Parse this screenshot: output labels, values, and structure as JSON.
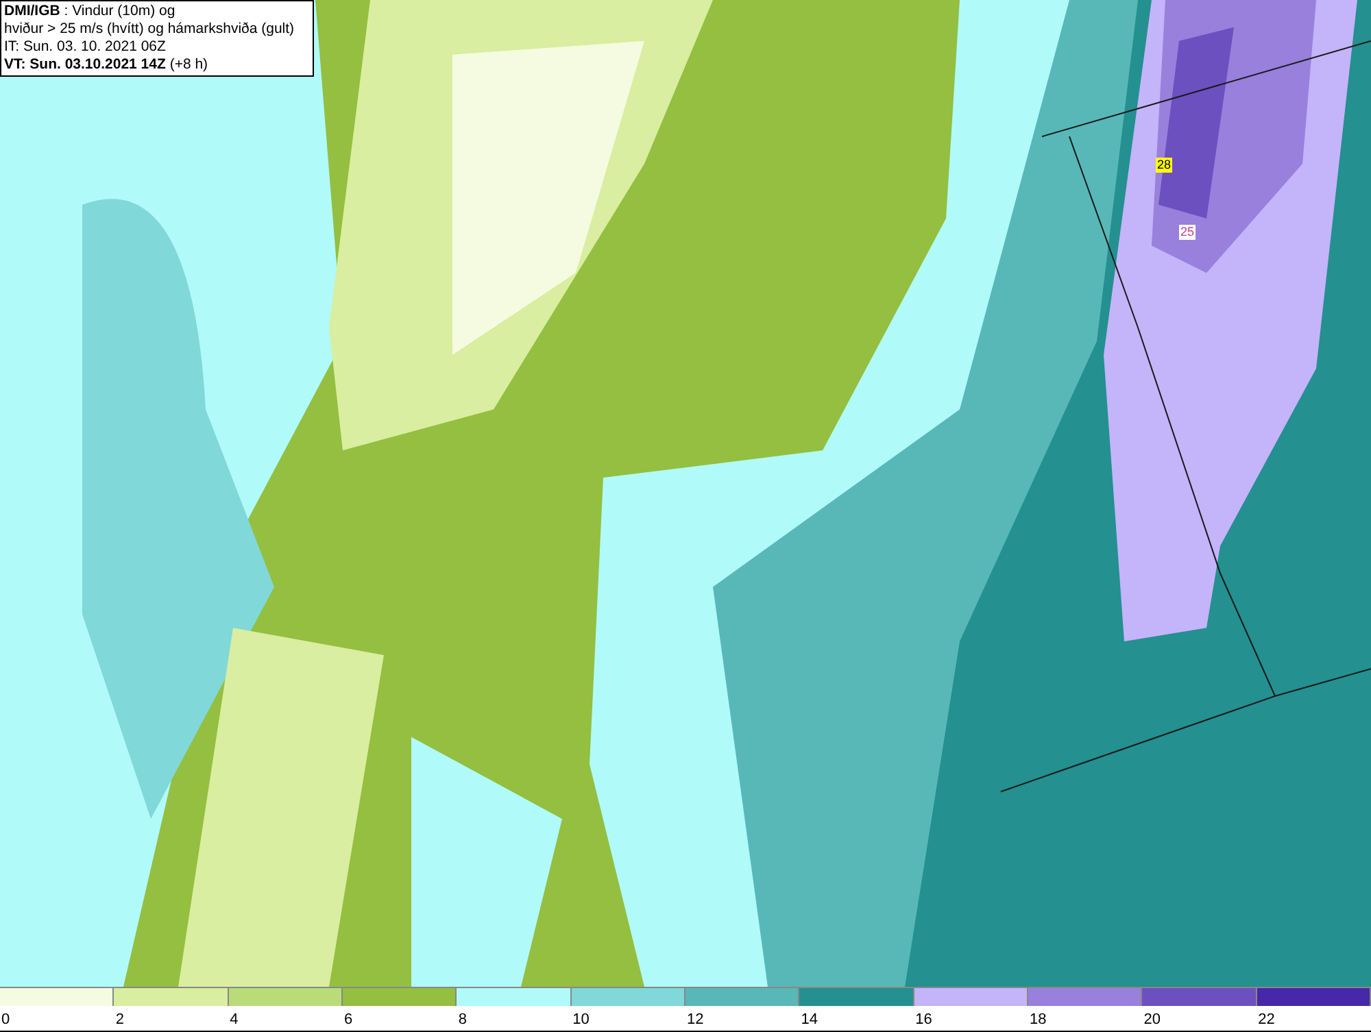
{
  "title_box": {
    "lines": [
      "**DMI/IGB** : Vindur (10m) og",
      "hviður > 25 m/s (hvítt) og hámarkshviða (gult)",
      "IT: Sun. 03. 10. 2021 06Z",
      "**VT: Sun. 03.10.2021 14Z** (+8 h)"
    ]
  },
  "map_labels": [
    {
      "text": "28",
      "kind": "gust"
    },
    {
      "text": "25",
      "kind": "isoline"
    }
  ],
  "legend": [
    {
      "label": "0",
      "color": "#f5fbe0"
    },
    {
      "label": "2",
      "color": "#d9eea0"
    },
    {
      "label": "4",
      "color": "#b9dc78"
    },
    {
      "label": "6",
      "color": "#94bf40"
    },
    {
      "label": "8",
      "color": "#b0fafa"
    },
    {
      "label": "10",
      "color": "#80d8d8"
    },
    {
      "label": "12",
      "color": "#58b8b8"
    },
    {
      "label": "14",
      "color": "#249090"
    },
    {
      "label": "16",
      "color": "#c4b4fa"
    },
    {
      "label": "18",
      "color": "#9880dc"
    },
    {
      "label": "20",
      "color": "#6c50c0"
    },
    {
      "label": "22",
      "color": "#4628a8"
    }
  ]
}
